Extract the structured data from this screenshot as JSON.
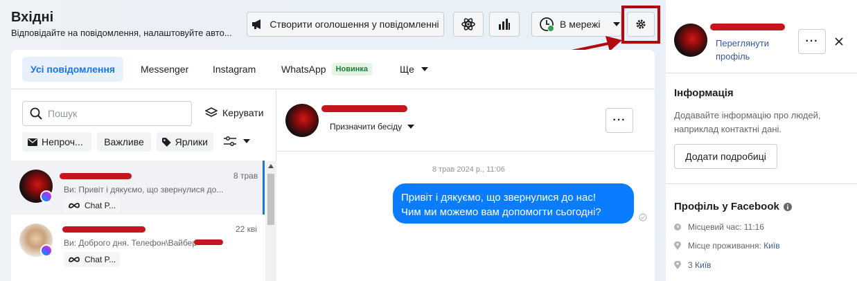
{
  "header": {
    "title": "Вхідні",
    "subtitle": "Відповідайте на повідомлення, налаштовуйте авто...",
    "create_ad_label": "Створити оголошення у повідомленні",
    "status_label": "В мережі"
  },
  "tabs": [
    {
      "label": "Усі повідомлення"
    },
    {
      "label": "Messenger"
    },
    {
      "label": "Instagram"
    },
    {
      "label": "WhatsApp"
    },
    {
      "label": "Ще"
    }
  ],
  "whatsapp_badge": "Новинка",
  "list": {
    "search_placeholder": "Пошук",
    "manage_label": "Керувати",
    "filters": [
      {
        "label": "Непроч..."
      },
      {
        "label": "Важливе"
      },
      {
        "label": "Ярлики"
      }
    ],
    "conversations": [
      {
        "preview": "Ви: Привіт і дякуємо, що звернулися до...",
        "date": "8 трав",
        "tag": "Chat P..."
      },
      {
        "preview": "Ви: Доброго дня. Телефон\\Вайбер",
        "date": "22 кві",
        "tag": "Chat P..."
      }
    ]
  },
  "chat": {
    "assign_label": "Призначити бесіду",
    "timestamp": "8 трав 2024 р., 11:06",
    "message_line1": "Привіт і дякуємо, що звернулися до нас!",
    "message_line2": "Чим ми можемо вам допомогти сьогодні?"
  },
  "profile": {
    "view_profile_line1": "Переглянути",
    "view_profile_line2": "профіль",
    "info_title": "Інформація",
    "info_text_line1": "Додавайте інформацію про людей,",
    "info_text_line2": "наприклад контактні дані.",
    "add_details_label": "Додати подробиці",
    "fb_profile_title": "Профіль у Facebook",
    "local_time": "Місцевий час: 11:16",
    "residence_label": "Місце проживання:",
    "residence_value": "Київ",
    "third_row_prefix": "3",
    "third_row_value": "Київ"
  },
  "colors": {
    "accent": "#1b74e4",
    "bubble": "#0a7cff",
    "annotation": "#b3080c",
    "online": "#31a24c"
  }
}
